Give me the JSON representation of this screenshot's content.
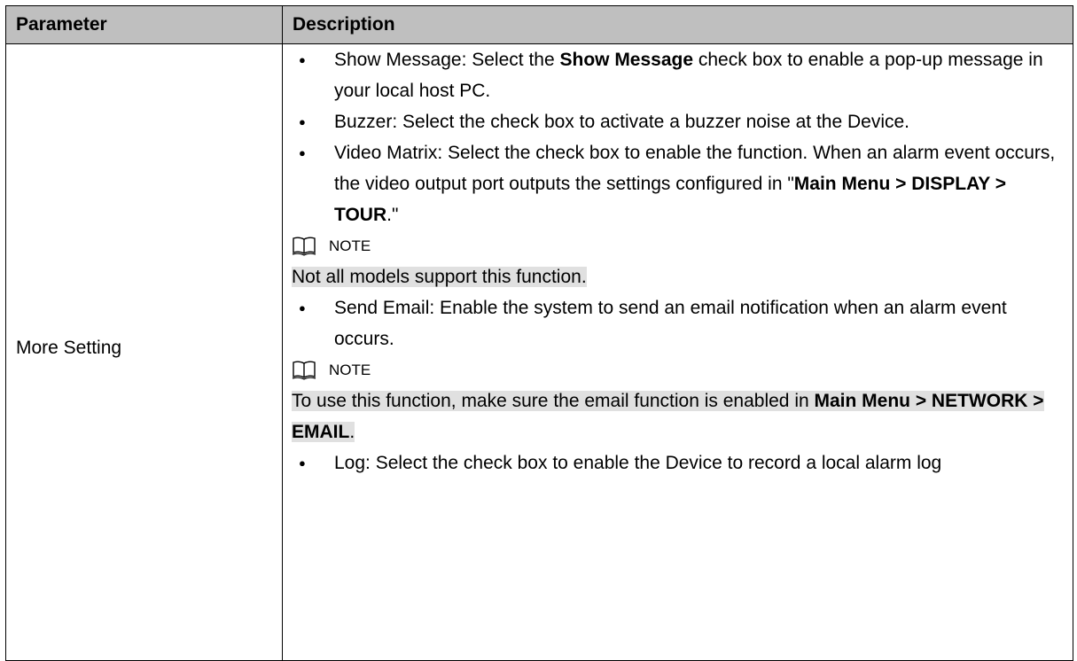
{
  "table": {
    "headers": {
      "parameter": "Parameter",
      "description": "Description"
    },
    "row": {
      "parameter": "More Setting",
      "items": {
        "show_message": {
          "prefix": "Show Message: Select the ",
          "bold": "Show Message",
          "suffix": " check box to enable a pop-up message in your local host PC."
        },
        "buzzer": {
          "text": "Buzzer: Select the check box to activate a buzzer noise at the Device."
        },
        "video_matrix": {
          "prefix": "Video Matrix: Select the check box to enable the function. When an alarm event occurs, the video output port outputs the settings configured in \"",
          "bold": "Main Menu > DISPLAY > TOUR",
          "suffix": ".\""
        },
        "note1": {
          "label": "NOTE",
          "text": "Not all models support this function."
        },
        "send_email": {
          "text": "Send Email: Enable the system to send an email notification when an alarm event occurs."
        },
        "note2": {
          "label": "NOTE",
          "prefix": "To use this function, make sure the email function is enabled in ",
          "bold": "Main Menu > NETWORK > EMAIL",
          "suffix": "."
        },
        "log": {
          "text": "Log: Select the check box to enable the Device to record a local alarm log"
        }
      },
      "bullet_glyph": "●",
      "note_icon": "book-icon"
    }
  }
}
